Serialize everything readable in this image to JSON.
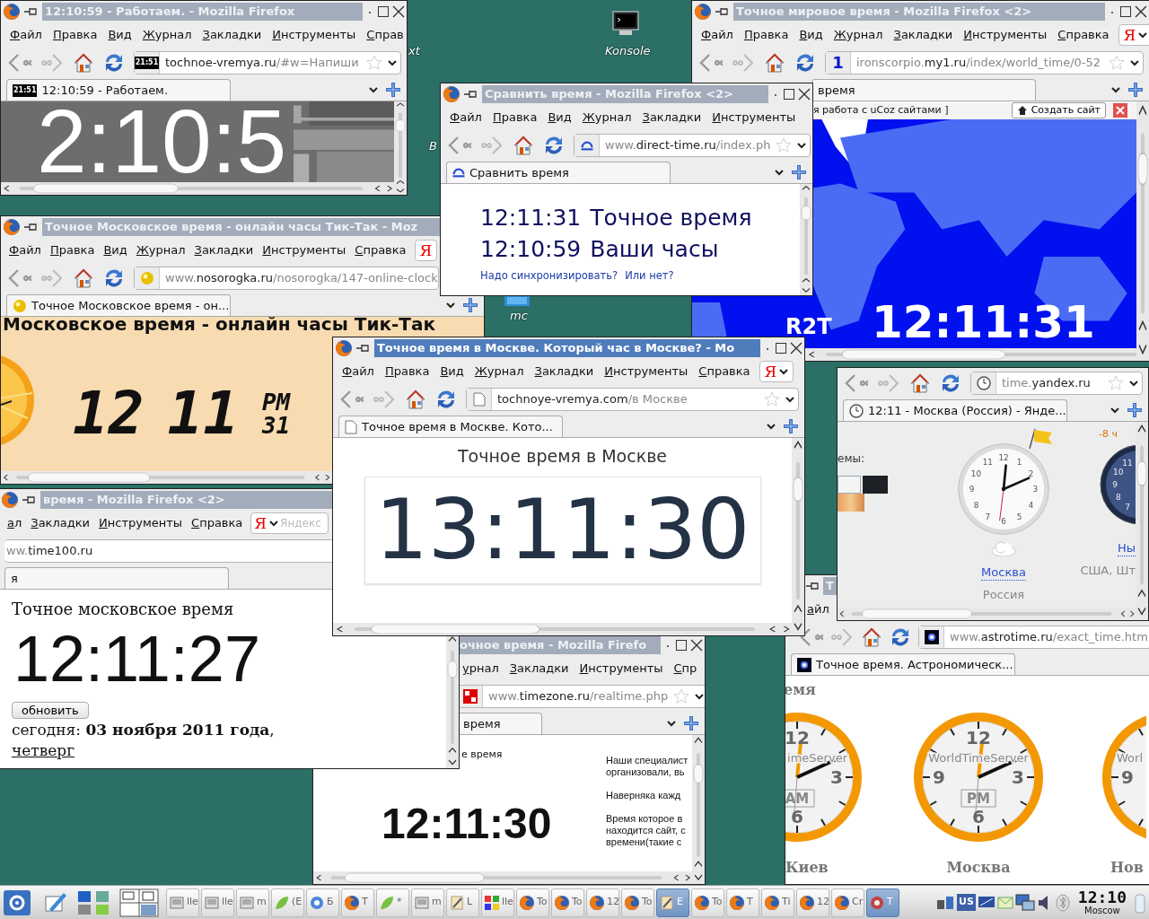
{
  "desktop": {
    "icons": [
      {
        "label": "xt"
      },
      {
        "label": "Konsole"
      },
      {
        "label": "B"
      },
      {
        "label": "mc"
      }
    ]
  },
  "windows": [
    {
      "title": "12:10:59 - Работаем. - Mozilla Firefox",
      "active": false,
      "menu": [
        "Файл",
        "Правка",
        "Вид",
        "Журнал",
        "Закладки",
        "Инструменты",
        "Справ"
      ],
      "favicon": {
        "kind": "badge",
        "text": "21:51"
      },
      "url": {
        "domain": "tochnoe-vremya.ru",
        "path": "/#w=Напиши"
      },
      "tab": {
        "label": "12:10:59 - Работаем.",
        "favicon": {
          "kind": "badge",
          "text": "21:51"
        }
      },
      "content": {
        "kind": "photo_clock",
        "clock": "2:10:5"
      }
    },
    {
      "title": "Точное мировое время - Mozilla Firefox <2>",
      "active": false,
      "menu": [
        "Файл",
        "Правка",
        "Вид",
        "Журнал",
        "Закладки",
        "Инструменты",
        "Справка"
      ],
      "yandex": {
        "logo": "Я"
      },
      "favicon": {
        "kind": "digit",
        "text": "1"
      },
      "url": {
        "prefix": "ironscorpio.",
        "domain": "my1.ru",
        "path": "/index/world_time/0-52"
      },
      "tab": {
        "label": "время"
      },
      "content": {
        "kind": "world_map",
        "bar_text": "я работа с uCoz сайтами ]",
        "bar_button": "Создать сайт",
        "brand": "R2T",
        "clock": "12:11:31"
      }
    },
    {
      "title": "Сравнить время - Mozilla Firefox <2>",
      "active": false,
      "menu": [
        "Файл",
        "Правка",
        "Вид",
        "Журнал",
        "Закладки",
        "Инструменты"
      ],
      "favicon": {
        "kind": "dt"
      },
      "url": {
        "prefix": "www.",
        "domain": "direct-time.ru",
        "path": "/index.ph"
      },
      "tab": {
        "label": "Сравнить время",
        "favicon": {
          "kind": "dt"
        }
      },
      "content": {
        "kind": "compare",
        "rows": [
          {
            "time": "12:11:31",
            "label": "Точное время"
          },
          {
            "time": "12:10:59",
            "label": "Ваши часы"
          }
        ],
        "links": [
          "Надо синхронизировать?",
          "Или нет?"
        ]
      }
    },
    {
      "title": "Точное Московское время - онлайн часы Тик-Так - Moz",
      "active": false,
      "menu": [
        "Файл",
        "Правка",
        "Вид",
        "Журнал",
        "Закладки",
        "Инструменты",
        "Справка"
      ],
      "yandex": {
        "logo": "Я"
      },
      "favicon": {
        "kind": "ball"
      },
      "url": {
        "prefix": "www.",
        "domain": "nosorogka.ru",
        "path": "/nosorogka/147-online-clock"
      },
      "tab": {
        "label": "Точное Московское время - он...",
        "favicon": {
          "kind": "ball"
        }
      },
      "content": {
        "kind": "lcd_clock",
        "heading": "Московское время - онлайн часы Тик-Так",
        "hours": "12",
        "minutes": "11",
        "ampm": "PM",
        "seconds": "31"
      }
    },
    {
      "title": "Точное время в Москве. Который час в Москве? - Mo",
      "active": true,
      "menu": [
        "Файл",
        "Правка",
        "Вид",
        "Журнал",
        "Закладки",
        "Инструменты",
        "Справка"
      ],
      "yandex": {
        "logo": "Я"
      },
      "favicon": {
        "kind": "page"
      },
      "url": {
        "domain": "tochnoye-vremya.com",
        "path": "/в Москве"
      },
      "tab": {
        "label": "Точное время в Москве. Кото...",
        "favicon": {
          "kind": "page"
        }
      },
      "content": {
        "kind": "moscow",
        "heading": "Точное время в Москве",
        "clock": "13:11:30"
      }
    },
    {
      "favicon": {
        "kind": "clock"
      },
      "url": {
        "prefix": "time.",
        "domain": "yandex.ru"
      },
      "tab": {
        "label": "12:11 - Москва (Россия) - Янде...",
        "favicon": {
          "kind": "clock"
        }
      },
      "content": {
        "kind": "yandex_clocks",
        "themes_label": "емы:",
        "clocks": [
          {
            "city": "Москва",
            "country": "Россия",
            "numerals": [
              "1",
              "2",
              "3",
              "4",
              "5",
              "6",
              "7",
              "8",
              "9",
              "10",
              "11",
              "12"
            ]
          },
          {
            "offset": "-8 ч",
            "city": "Ны",
            "country": "США, Шт",
            "numerals": [
              "11",
              "10",
              "9",
              "8",
              "7"
            ]
          }
        ]
      }
    },
    {
      "title": "время - Mozilla Firefox <2>",
      "active": false,
      "menu": [
        "ал",
        "Закладки",
        "Инструменты",
        "Справка"
      ],
      "yandex": {
        "logo": "Я",
        "placeholder": "Яндекс"
      },
      "url": {
        "prefix": "ww.",
        "domain": "time100.ru"
      },
      "tab": {
        "label": "я"
      },
      "content": {
        "kind": "time100",
        "heading": "Точное московское время",
        "clock": "12:11:27",
        "button": "обновить",
        "date": "сегодня: **03 ноября 2011 года**,",
        "weekday": "четверг"
      }
    },
    {
      "title": "Т",
      "active": false,
      "menu": [
        "айл"
      ],
      "favicon": {
        "kind": "star"
      },
      "url": {
        "prefix": "www.",
        "domain": "astrotime.ru",
        "path": "/exact_time.htm"
      },
      "tab": {
        "label": "Точное время. Астрономическ...",
        "favicon": {
          "kind": "star"
        }
      },
      "content": {
        "kind": "astro_clocks",
        "heading": "емя",
        "clocks": [
          {
            "city": "Киев",
            "brand": "imeServer",
            "period": "AM",
            "numerals": [
              "12",
              "3",
              "6"
            ]
          },
          {
            "city": "Москва",
            "brand": "WorldTimeServer",
            "period": "PM",
            "numerals": [
              "12",
              "3",
              "6",
              "9"
            ]
          },
          {
            "city": "Нов",
            "brand": "Worl",
            "numerals": [
              "9"
            ]
          }
        ]
      }
    },
    {
      "title": "очное время - Mozilla Firefo",
      "active": false,
      "menu": [
        "урнал",
        "Закладки",
        "Инструменты",
        "Спр"
      ],
      "favicon": {
        "kind": "tz"
      },
      "url": {
        "prefix": "www.",
        "domain": "timezone.ru",
        "path": "/realtime.php"
      },
      "tab": {
        "label": "время"
      },
      "content": {
        "kind": "timezone",
        "heading": "е время",
        "clock": "12:11:30",
        "notes": [
          {
            "lines": [
              "Наши специалист",
              "организовали, вь"
            ]
          },
          {
            "lines": [
              "Наверняка кажд"
            ]
          },
          {
            "lines": [
              "Время которое в",
              "находится сайт, с",
              "времени(такие с"
            ]
          }
        ]
      }
    }
  ],
  "taskbar": {
    "items": [
      {
        "kind": "app",
        "label": "lle",
        "selected": false
      },
      {
        "kind": "app",
        "label": "lle",
        "selected": false
      },
      {
        "kind": "app",
        "label": "m",
        "selected": false
      },
      {
        "kind": "leaf",
        "label": "(E",
        "selected": false
      },
      {
        "kind": "globe",
        "label": "Б",
        "selected": false
      },
      {
        "kind": "firefox",
        "label": "T",
        "selected": false
      },
      {
        "kind": "leaf",
        "label": "*",
        "selected": false
      },
      {
        "kind": "app",
        "label": "m",
        "selected": false
      },
      {
        "kind": "note",
        "label": "L",
        "selected": false
      },
      {
        "kind": "mosaic",
        "label": "lle",
        "selected": false
      },
      {
        "kind": "firefox",
        "label": "To",
        "selected": false
      },
      {
        "kind": "firefox",
        "label": "To",
        "selected": false
      },
      {
        "kind": "firefox",
        "label": "12",
        "selected": false
      },
      {
        "kind": "firefox",
        "label": "To",
        "selected": false
      },
      {
        "kind": "note",
        "label": "E",
        "selected": true
      },
      {
        "kind": "firefox",
        "label": "To",
        "selected": false
      },
      {
        "kind": "firefox",
        "label": "T",
        "selected": false
      },
      {
        "kind": "firefox",
        "label": "Ti",
        "selected": false
      },
      {
        "kind": "firefox",
        "label": "12",
        "selected": false
      },
      {
        "kind": "firefox",
        "label": "Cr",
        "selected": false
      },
      {
        "kind": "gear",
        "label": "T",
        "selected": true
      }
    ],
    "keyboard": "US",
    "clock": "12:10",
    "city": "Moscow"
  }
}
